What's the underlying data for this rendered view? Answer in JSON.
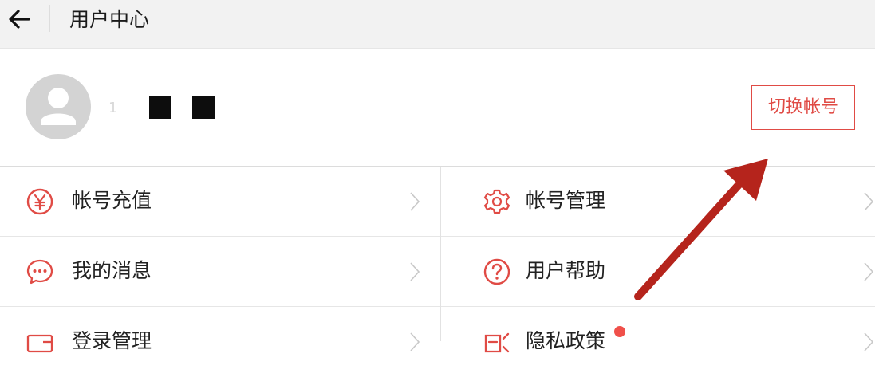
{
  "header": {
    "title": "用户中心"
  },
  "profile": {
    "username_visible": "1"
  },
  "switch_account": {
    "label": "切换帐号"
  },
  "menu": {
    "items": [
      {
        "label": "帐号充值",
        "icon": "yuan-circle-icon"
      },
      {
        "label": "帐号管理",
        "icon": "gear-icon"
      },
      {
        "label": "我的消息",
        "icon": "chat-bubble-icon"
      },
      {
        "label": "用户帮助",
        "icon": "question-circle-icon"
      },
      {
        "label": "登录管理",
        "icon": "login-device-icon"
      },
      {
        "label": "隐私政策",
        "icon": "privacy-icon"
      }
    ]
  },
  "colors": {
    "accent": "#e04b45",
    "header_bg": "#f2f2f2",
    "annotation_arrow": "#b5241c"
  }
}
